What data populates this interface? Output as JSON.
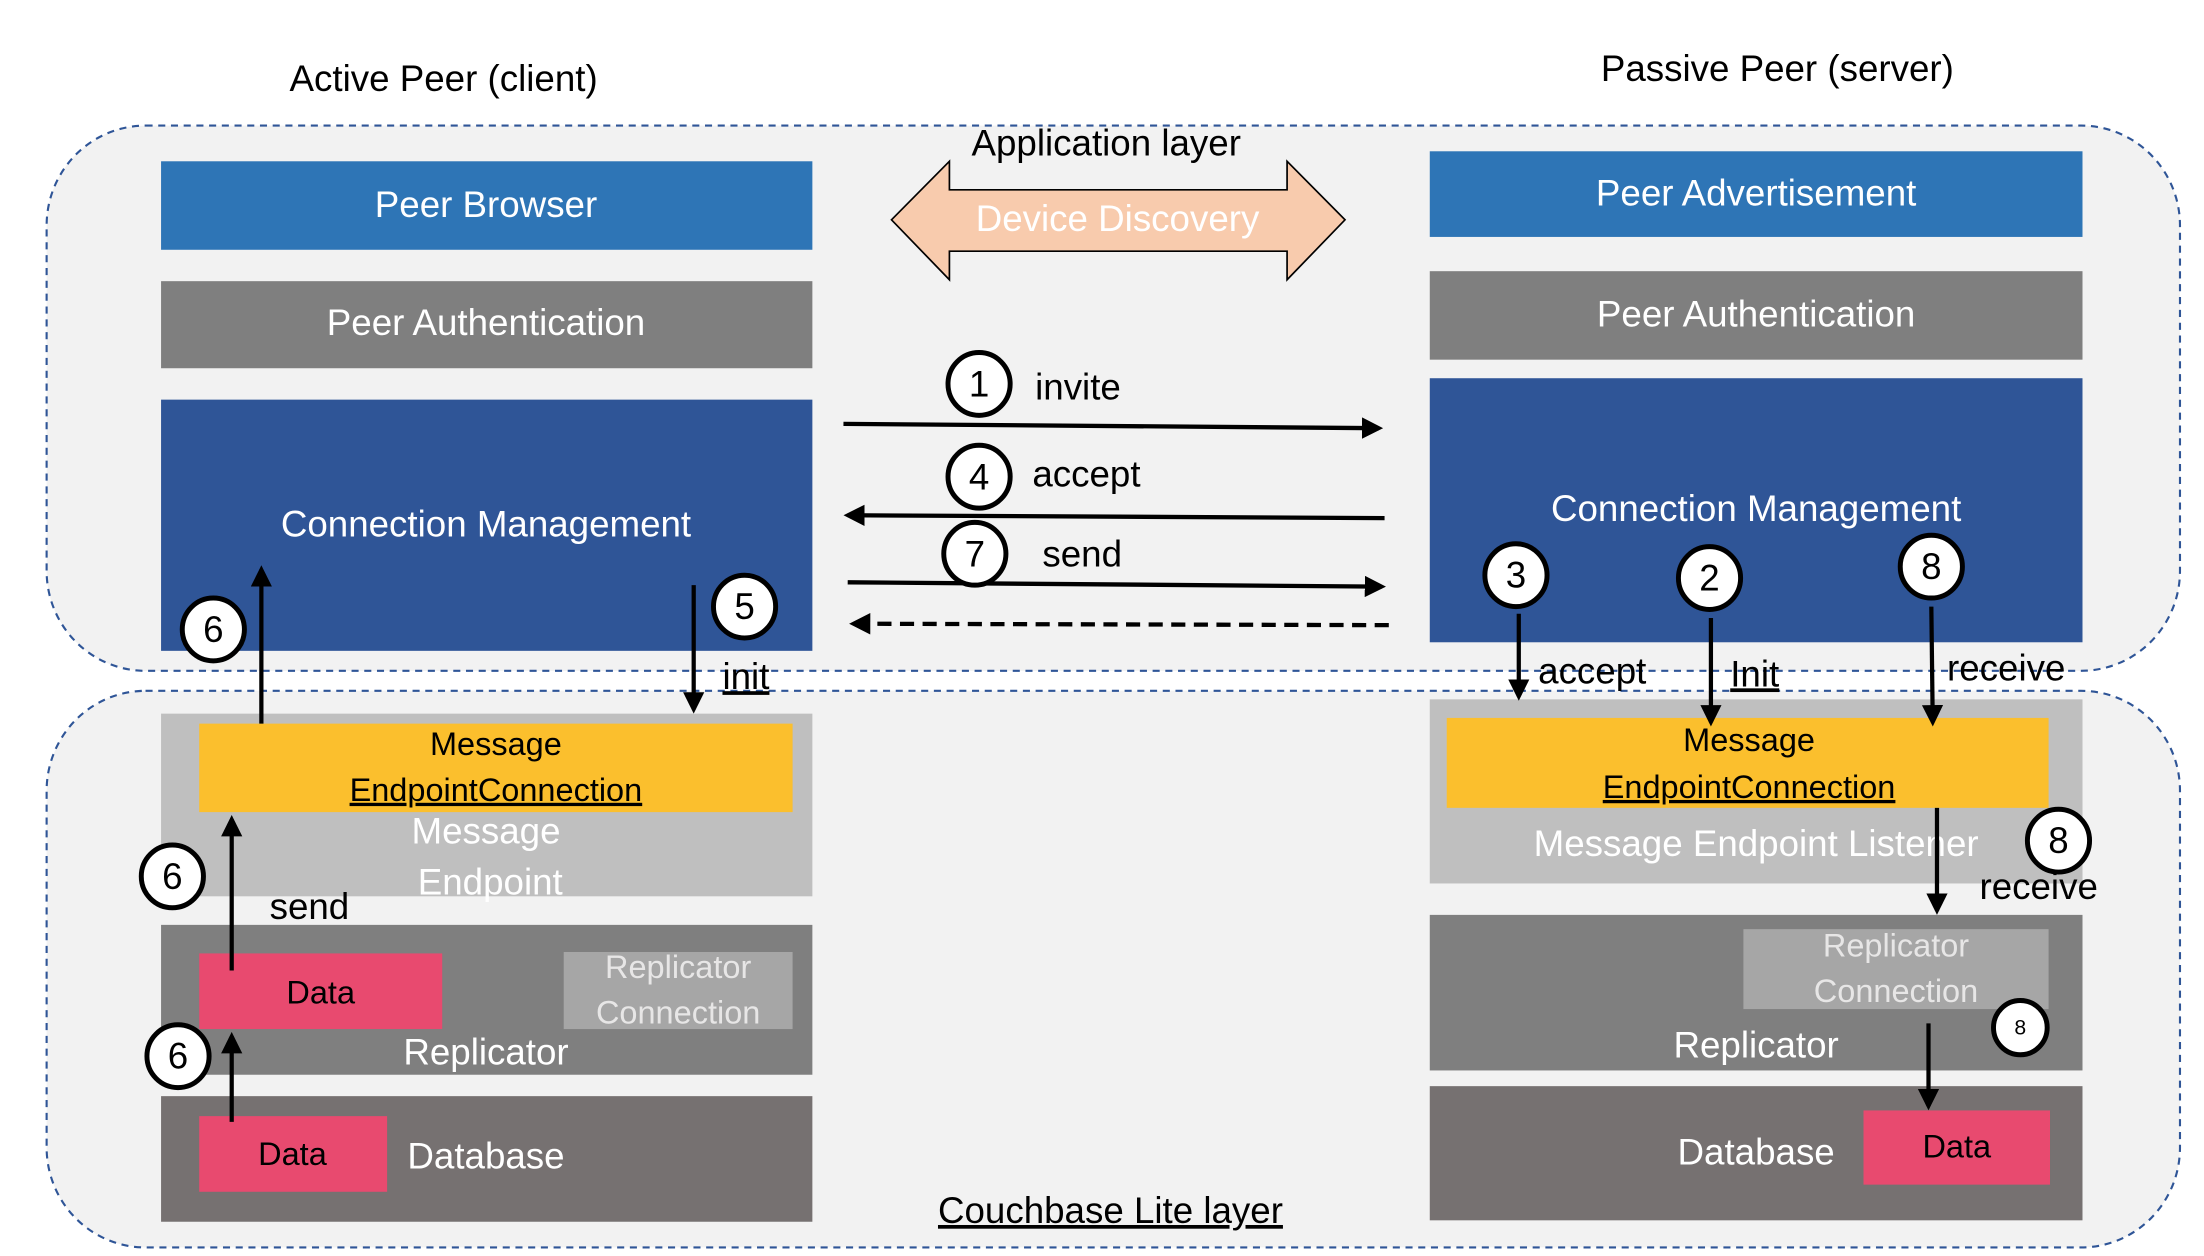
{
  "headers": {
    "active_peer": "Active Peer (client)",
    "passive_peer": "Passive Peer (server)"
  },
  "layers": {
    "application": "Application layer",
    "couchbase": "Couchbase Lite layer"
  },
  "device_discovery": "Device Discovery",
  "client": {
    "peer_browser": "Peer Browser",
    "peer_authentication": "Peer Authentication",
    "connection_management": "Connection Management",
    "message_endpoint_connection": [
      "Message",
      "EndpointConnection"
    ],
    "message_endpoint": [
      "Message",
      "Endpoint"
    ],
    "replicator": "Replicator",
    "replicator_connection": [
      "Replicator",
      "Connection"
    ],
    "data_replicator": "Data",
    "database": "Database",
    "data_database": "Data"
  },
  "server": {
    "peer_advertisement": "Peer Advertisement",
    "peer_authentication": "Peer Authentication",
    "connection_management": "Connection Management",
    "message_endpoint_connection": [
      "Message",
      "EndpointConnection"
    ],
    "message_endpoint_listener": "Message Endpoint Listener",
    "replicator": "Replicator",
    "replicator_connection": [
      "Replicator",
      "Connection"
    ],
    "database": "Database",
    "data_database": "Data"
  },
  "steps": {
    "s1": {
      "num": "1",
      "label": "invite"
    },
    "s4": {
      "num": "4",
      "label": "accept"
    },
    "s7": {
      "num": "7",
      "label": "send"
    },
    "s5": {
      "num": "5",
      "label": "init"
    },
    "s6a": {
      "num": "6"
    },
    "s6b": {
      "num": "6",
      "label": "send"
    },
    "s6c": {
      "num": "6"
    },
    "s3": {
      "num": "3",
      "label": "accept"
    },
    "s2": {
      "num": "2",
      "label": "Init"
    },
    "s8a": {
      "num": "8",
      "label": "receive"
    },
    "s8b": {
      "num": "8",
      "label": "receive"
    },
    "s8c": {
      "num": "8"
    }
  },
  "colors": {
    "blue_light": "#2e75b6",
    "blue_dark": "#2f5597",
    "gray": "#7f7f7f",
    "gray_light": "#bfbfbf",
    "gray_db": "#767171",
    "yellow": "#fbbf2d",
    "pink": "#e84a6f",
    "peach": "#f8cbad"
  }
}
